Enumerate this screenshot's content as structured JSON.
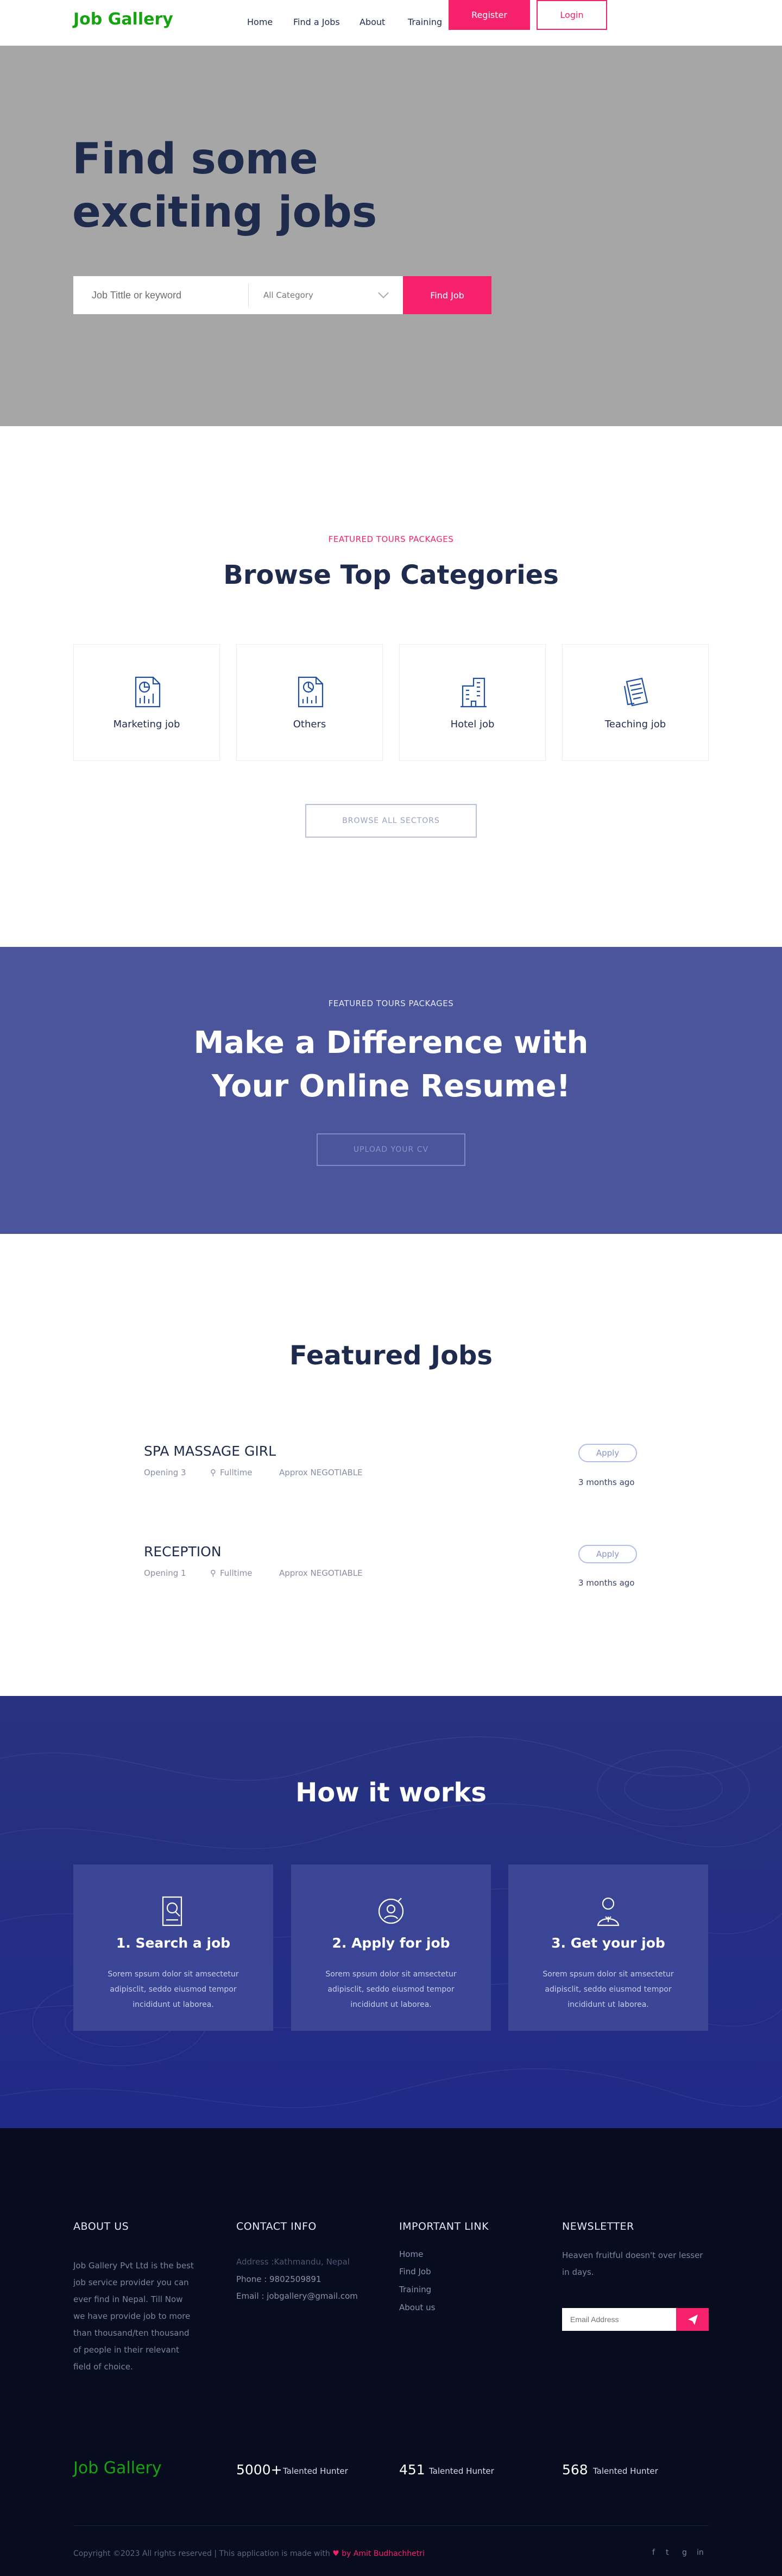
{
  "header": {
    "logo": "Job Gallery",
    "nav": [
      "Home",
      "Find a Jobs",
      "About",
      "Training"
    ],
    "register": "Register",
    "login": "Login"
  },
  "hero": {
    "title": "Find some exciting jobs",
    "search_placeholder": "Job Tittle or keyword",
    "category": "All Category",
    "find_button": "Find Job"
  },
  "categories": {
    "eyebrow": "FEATURED TOURS PACKAGES",
    "title": "Browse Top Categories",
    "items": [
      {
        "label": "Marketing job",
        "icon": "marketing-report-icon"
      },
      {
        "label": "Others",
        "icon": "document-chart-icon"
      },
      {
        "label": "Hotel job",
        "icon": "hotel-building-icon"
      },
      {
        "label": "Teaching job",
        "icon": "teaching-notes-icon"
      }
    ],
    "browse_button": "BROWSE ALL SECTORS"
  },
  "resume": {
    "eyebrow": "FEATURED TOURS PACKAGES",
    "title": "Make a Difference with Your Online Resume!",
    "button": "UPLOAD YOUR CV"
  },
  "featured_jobs": {
    "title": "Featured Jobs",
    "jobs": [
      {
        "title": "SPA MASSAGE GIRL",
        "opening": "Opening 3",
        "type": "Fulltime",
        "salary": "Approx NEGOTIABLE",
        "apply": "Apply",
        "posted": "3 months ago"
      },
      {
        "title": "RECEPTION",
        "opening": "Opening 1",
        "type": "Fulltime",
        "salary": "Approx NEGOTIABLE",
        "apply": "Apply",
        "posted": "3 months ago"
      }
    ]
  },
  "how": {
    "title": "How it works",
    "steps": [
      {
        "title": "1. Search a job",
        "desc": "Sorem spsum dolor sit amsectetur adipisclit, seddo eiusmod tempor incididunt ut laborea.",
        "icon": "search-job-icon"
      },
      {
        "title": "2. Apply for job",
        "desc": "Sorem spsum dolor sit amsectetur adipisclit, seddo eiusmod tempor incididunt ut laborea.",
        "icon": "apply-job-icon"
      },
      {
        "title": "3. Get your job",
        "desc": "Sorem spsum dolor sit amsectetur adipisclit, seddo eiusmod tempor incididunt ut laborea.",
        "icon": "get-job-icon"
      }
    ]
  },
  "footer": {
    "about_head": "ABOUT US",
    "about_text": "Job Gallery Pvt Ltd is the best job service provider you can ever find in Nepal. Till Now we have provide job to more than thousand/ten thousand of people in their relevant field of choice.",
    "contact_head": "CONTACT INFO",
    "address": "Address :Kathmandu, Nepal",
    "phone": "Phone : 9802509891",
    "email": "Email : jobgallery@gmail.com",
    "links_head": "IMPORTANT LINK",
    "links": [
      "Home",
      "Find Job",
      "Training",
      "About us"
    ],
    "news_head": "NEWSLETTER",
    "news_text": "Heaven fruitful doesn't over lesser in days.",
    "news_placeholder": "Email Address",
    "logo": "Job Gallery",
    "stats": [
      {
        "num": "5000+",
        "label": "Talented Hunter"
      },
      {
        "num": "451",
        "label": "Talented Hunter"
      },
      {
        "num": "568",
        "label": "Talented Hunter"
      }
    ],
    "copyright_pre": "Copyright ©2023 All rights reserved | This application is made with",
    "copyright_by": "by",
    "author": "Amit Budhachhetri",
    "social": [
      "f",
      "t",
      "g",
      "in"
    ]
  },
  "colors": {
    "accent": "#f5226b",
    "brand_green": "#16a312",
    "navy": "#1f2b4d",
    "band": "#4a559c",
    "how_bg": "#27337f",
    "footer_bg": "#070c1e"
  }
}
